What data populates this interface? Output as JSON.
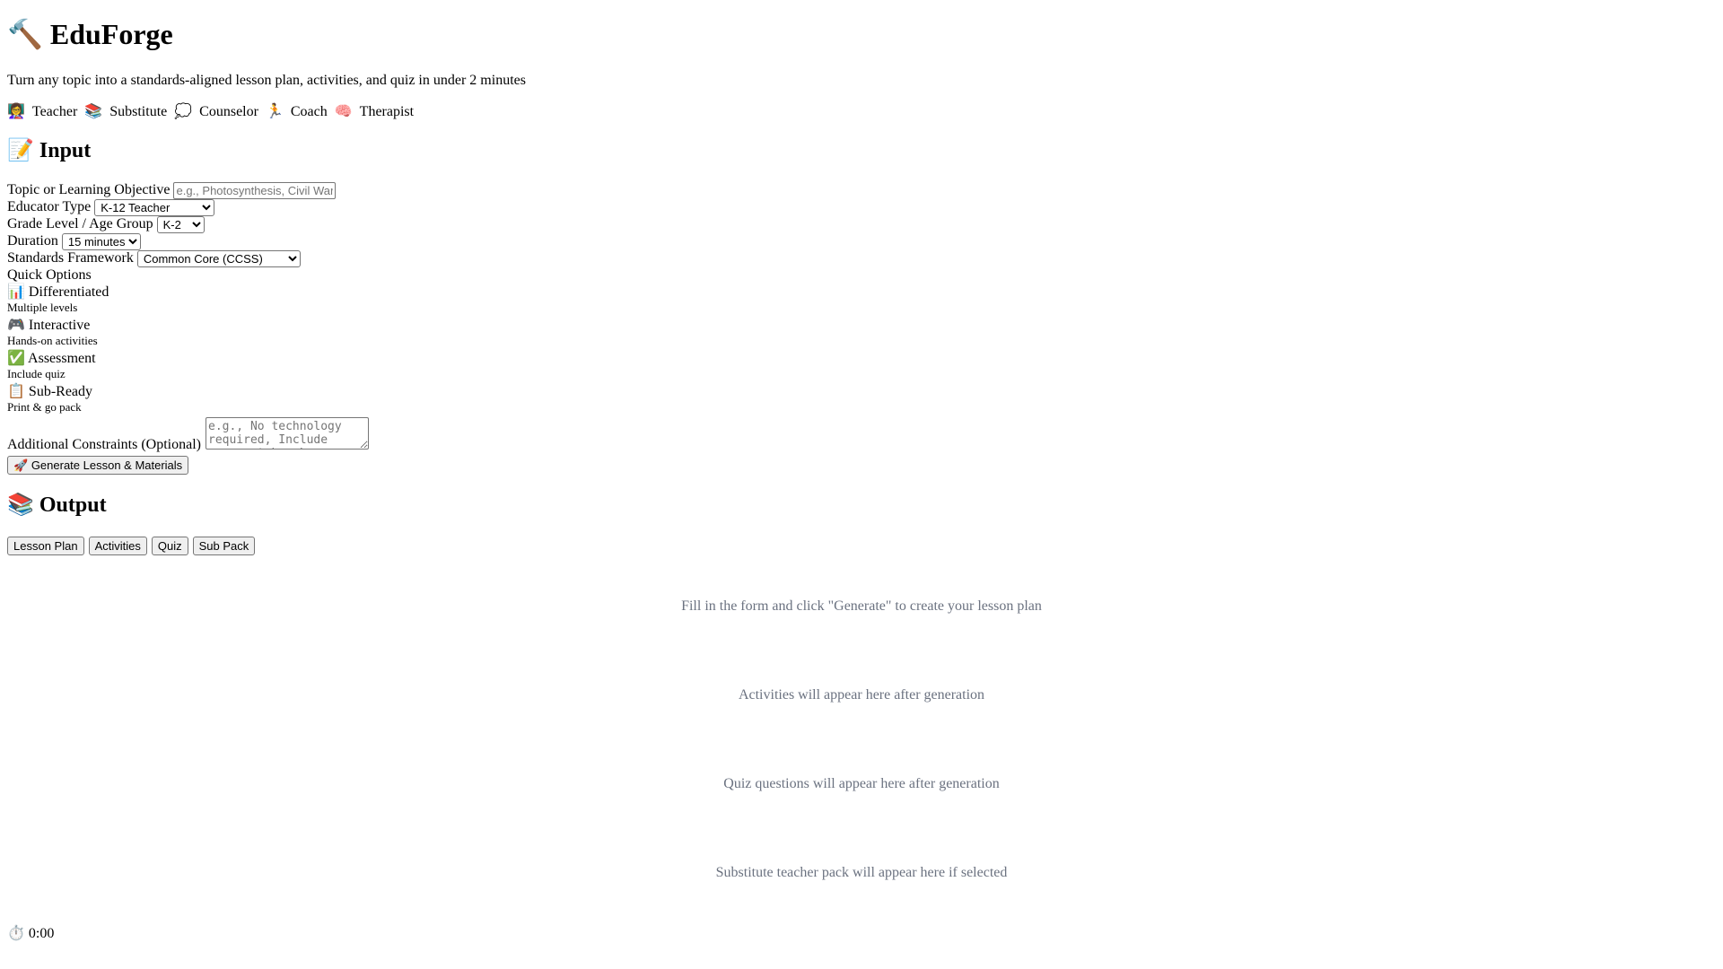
{
  "header": {
    "logo_icon": "🔨",
    "title": "EduForge",
    "tagline": "Turn any topic into a standards-aligned lesson plan, activities, and quiz in under 2 minutes"
  },
  "roles": [
    {
      "icon": "👩‍🏫",
      "label": "Teacher"
    },
    {
      "icon": "📚",
      "label": "Substitute"
    },
    {
      "icon": "💭",
      "label": "Counselor"
    },
    {
      "icon": "🏃",
      "label": "Coach"
    },
    {
      "icon": "🧠",
      "label": "Therapist"
    }
  ],
  "input_section": {
    "icon": "📝",
    "heading": "Input",
    "topic": {
      "label": "Topic or Learning Objective",
      "placeholder": "e.g., Photosynthesis, Civil War",
      "value": ""
    },
    "educator_type": {
      "label": "Educator Type",
      "selected": "K-12 Teacher"
    },
    "grade_level": {
      "label": "Grade Level / Age Group",
      "selected": "K-2"
    },
    "duration": {
      "label": "Duration",
      "selected": "15 minutes"
    },
    "standards": {
      "label": "Standards Framework",
      "selected": "Common Core (CCSS)"
    },
    "quick_options_label": "Quick Options",
    "quick_options": [
      {
        "icon": "📊",
        "title": "Differentiated",
        "desc": "Multiple levels"
      },
      {
        "icon": "🎮",
        "title": "Interactive",
        "desc": "Hands-on activities"
      },
      {
        "icon": "✅",
        "title": "Assessment",
        "desc": "Include quiz"
      },
      {
        "icon": "📋",
        "title": "Sub-Ready",
        "desc": "Print & go pack"
      }
    ],
    "constraints": {
      "label": "Additional Constraints (Optional)",
      "placeholder": "e.g., No technology required, Include movement breaks"
    },
    "generate_button": {
      "icon": "🚀",
      "label": "Generate Lesson & Materials"
    }
  },
  "output_section": {
    "icon": "📚",
    "heading": "Output",
    "tabs": [
      "Lesson Plan",
      "Activities",
      "Quiz",
      "Sub Pack"
    ],
    "messages": {
      "lesson_plan": "Fill in the form and click \"Generate\" to create your lesson plan",
      "activities": "Activities will appear here after generation",
      "quiz": "Quiz questions will appear here after generation",
      "sub_pack": "Substitute teacher pack will appear here if selected"
    }
  },
  "timer": {
    "icon": "⏱️",
    "value": "0:00"
  }
}
